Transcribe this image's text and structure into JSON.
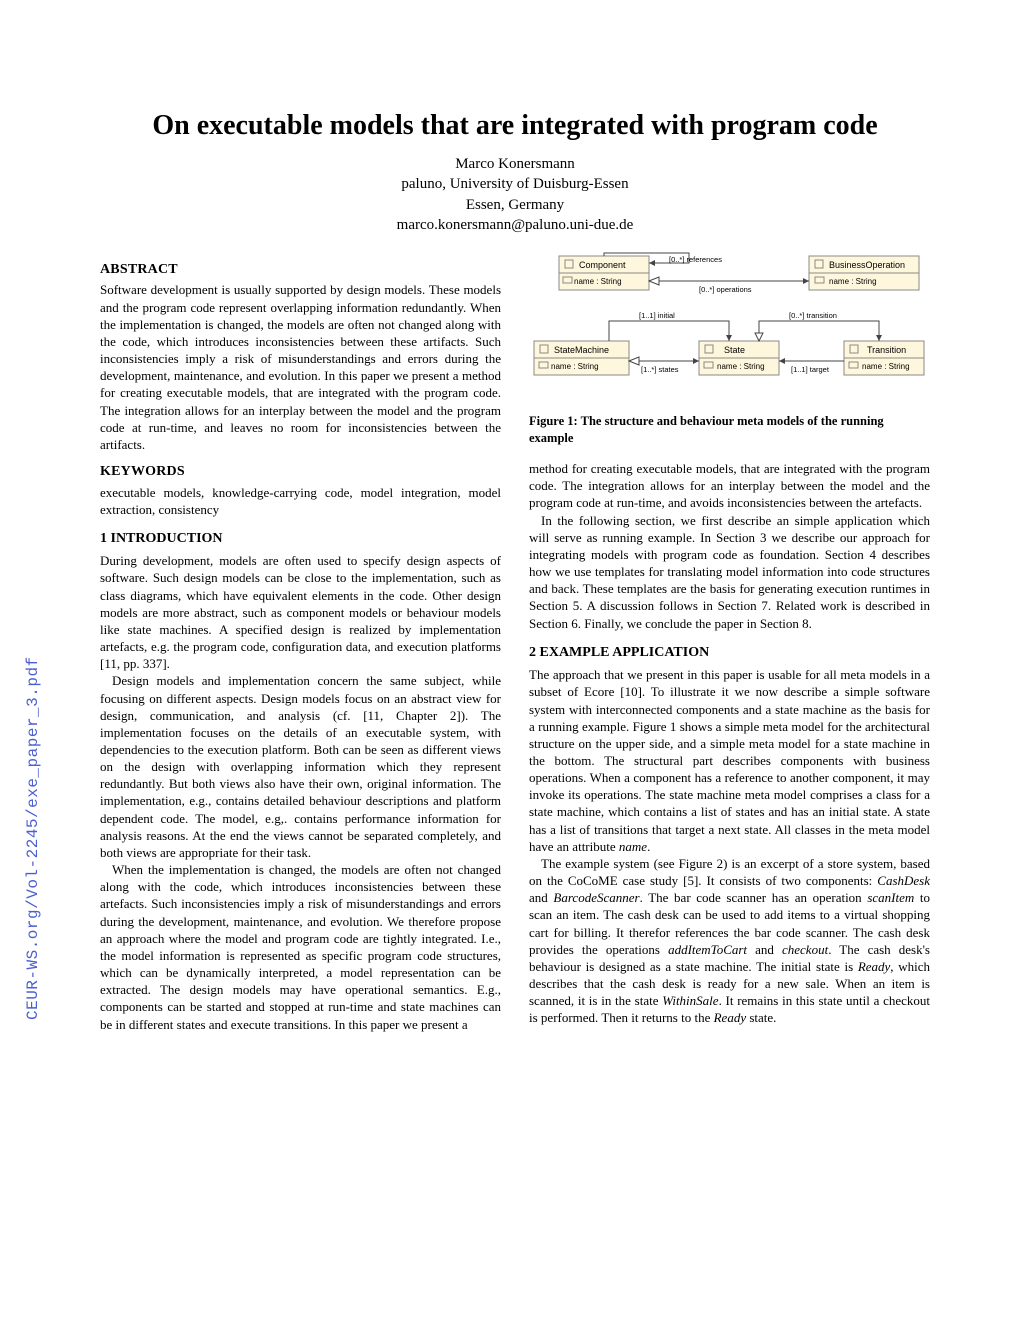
{
  "side_url": "CEUR-WS.org/Vol-2245/exe_paper_3.pdf",
  "title": "On executable models that are integrated with program code",
  "author": {
    "name": "Marco Konersmann",
    "affil": "paluno, University of Duisburg-Essen",
    "city": "Essen, Germany",
    "email": "marco.konersmann@paluno.uni-due.de"
  },
  "abstract": {
    "head": "ABSTRACT",
    "text": "Software development is usually supported by design models. These models and the program code represent overlapping information redundantly. When the implementation is changed, the models are often not changed along with the code, which introduces inconsistencies between these artifacts. Such inconsistencies imply a risk of misunderstandings and errors during the development, maintenance, and evolution. In this paper we present a method for creating executable models, that are integrated with the program code. The integration allows for an interplay between the model and the program code at run-time, and leaves no room for inconsistencies between the artifacts."
  },
  "keywords": {
    "head": "KEYWORDS",
    "text": "executable models, knowledge-carrying code, model integration, model extraction, consistency"
  },
  "sec1": {
    "head": "1   INTRODUCTION",
    "p1": "During development, models are often used to specify design aspects of software. Such design models can be close to the implementation, such as class diagrams, which have equivalent elements in the code. Other design models are more abstract, such as component models or behaviour models like state machines. A specified design is realized by implementation artefacts, e.g. the program code, configuration data, and execution platforms [11, pp. 337].",
    "p2": "Design models and implementation concern the same subject, while focusing on different aspects. Design models focus on an abstract view for design, communication, and analysis (cf. [11, Chapter 2]). The implementation focuses on the details of an executable system, with dependencies to the execution platform. Both can be seen as different views on the design with overlapping information which they represent redundantly. But both views also have their own, original information. The implementation, e.g., contains detailed behaviour descriptions and platform dependent code. The model, e.g,. contains performance information for analysis reasons. At the end the views cannot be separated completely, and both views are appropriate for their task.",
    "p3": "When the implementation is changed, the models are often not changed along with the code, which introduces inconsistencies between these artefacts. Such inconsistencies imply a risk of misunderstandings and errors during the development, maintenance, and evolution. We therefore propose an approach where the model and program code are tightly integrated. I.e., the model information is represented as specific program code structures, which can be dynamically interpreted, a model representation can be extracted. The design models may have operational semantics. E.g., components can be started and stopped at run-time and state machines can be in different states and execute transitions. In this paper we present a"
  },
  "figure1": {
    "caption": "Figure 1: The structure and behaviour meta models of the running example",
    "uml": {
      "component": "Component",
      "component_attr": "name : String",
      "bop": "BusinessOperation",
      "bop_attr": "name : String",
      "refs": "[0..*] references",
      "ops": "[0..*] operations",
      "sm": "StateMachine",
      "sm_attr": "name : String",
      "state": "State",
      "state_attr": "name : String",
      "transition": "Transition",
      "trans_attr": "name : String",
      "initial": "[1..1] initial",
      "trans": "[0..*] transition",
      "states": "[1..*] states",
      "target": "[1..1] target"
    }
  },
  "col2": {
    "p_lead": "method for creating executable models, that are integrated with the program code. The integration allows for an interplay between the model and the program code at run-time, and avoids inconsistencies between the artefacts.",
    "p_outline": "In the following section, we first describe an simple application which will serve as running example. In Section  3 we describe our approach for integrating models with program code as foundation. Section 4 describes how we use templates for translating model information into code structures and back. These templates are the basis for generating execution runtimes in Section 5. A discussion follows in Section 7. Related work is described in Section 6. Finally, we conclude the paper in Section 8."
  },
  "sec2": {
    "head": "2   EXAMPLE APPLICATION",
    "p1a": "The approach that we present in this paper is usable for all meta models in a subset of Ecore [10]. To illustrate it we now describe a simple software system with interconnected components and a state machine as the basis for a running example. Figure 1 shows a simple meta model for the architectural structure on the upper side, and a simple meta model for a state machine in the bottom. The structural part describes components with business operations. When a component has a reference to another component, it may invoke its operations. The state machine meta model comprises a class for a state machine, which contains a list of states and has an initial state. A state has a list of transitions that target a next state. All classes in the meta model have an attribute ",
    "p1_em": "name",
    "p1b": ".",
    "p2a": "The example system (see Figure 2) is an excerpt of a store system, based on the CoCoME case study [5]. It consists of two components: ",
    "p2_em1": "CashDesk",
    "p2b": " and ",
    "p2_em2": "BarcodeScanner",
    "p2c": ". The bar code scanner has an operation ",
    "p2_em3": "scanItem",
    "p2d": " to scan an item. The cash desk can be used to add items to a virtual shopping cart for billing. It therefor references the bar code scanner. The cash desk provides the operations ",
    "p2_em4": "addItemToCart",
    "p2e": " and ",
    "p2_em5": "checkout",
    "p2f": ". The cash desk's behaviour is designed as a state machine. The initial state is ",
    "p2_em6": "Ready",
    "p2g": ", which describes that the cash desk is ready for a new sale. When an item is scanned, it is in the state ",
    "p2_em7": "WithinSale",
    "p2h": ". It remains in this state until a checkout is performed. Then it returns to the ",
    "p2_em8": "Ready",
    "p2i": " state."
  }
}
